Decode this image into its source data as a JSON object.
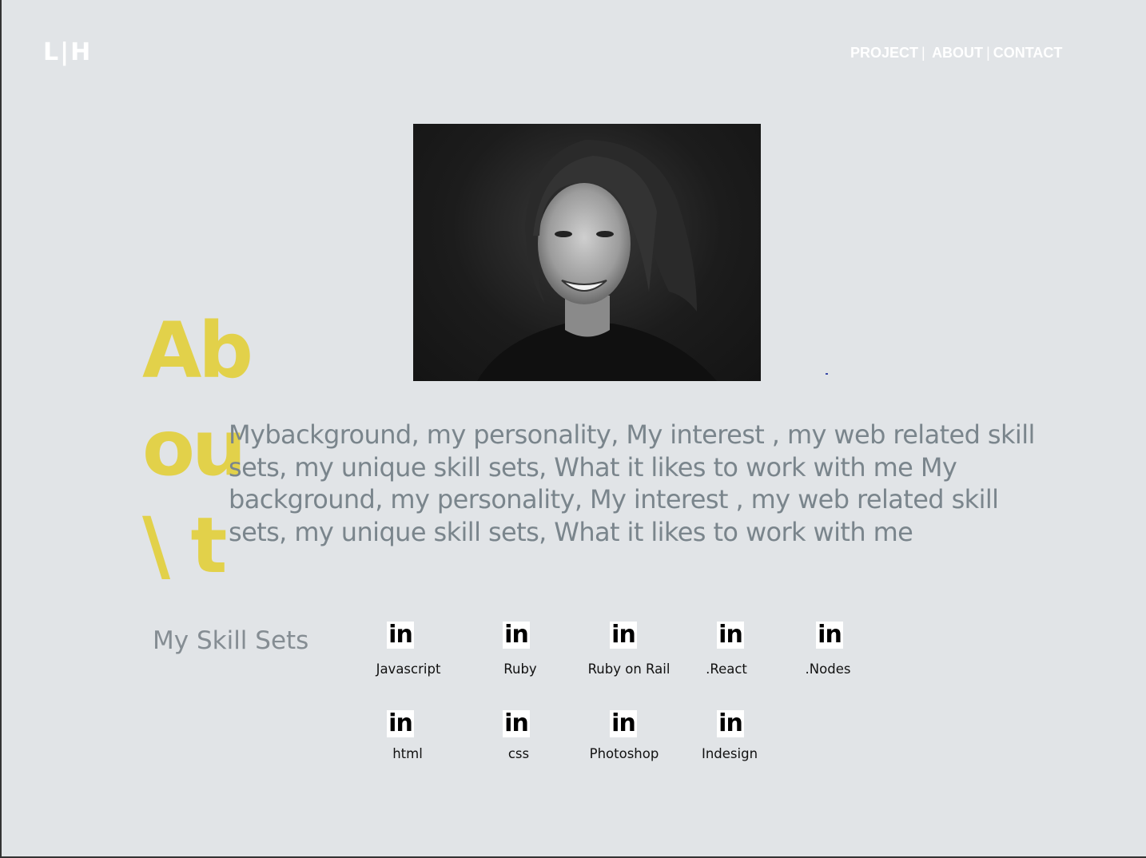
{
  "header": {
    "logo": "L|H",
    "nav": [
      {
        "label": "PROJECT"
      },
      {
        "label": "ABOUT"
      },
      {
        "label": "CONTACT"
      }
    ],
    "separator": "|"
  },
  "about": {
    "big_title_lines": [
      "Ab",
      "ou",
      "\\ t"
    ],
    "bio": "Mybackground, my personality, My interest , my web related skill sets, my unique skill sets, What it likes to work with me My background, my personality, My interest , my web related skill sets, my unique skill sets, What it likes to work with me"
  },
  "skills": {
    "title": "My Skill Sets",
    "icon_text": "in",
    "items": [
      {
        "label": "Javascript"
      },
      {
        "label": "Ruby"
      },
      {
        "label": "Ruby on Rail"
      },
      {
        "label": ".React"
      },
      {
        "label": ".Nodes"
      },
      {
        "label": "html"
      },
      {
        "label": "css"
      },
      {
        "label": "Photoshop"
      },
      {
        "label": "Indesign"
      }
    ]
  },
  "colors": {
    "background": "#e1e4e7",
    "accent_yellow": "#e2d14a",
    "body_text": "#7a858c"
  }
}
